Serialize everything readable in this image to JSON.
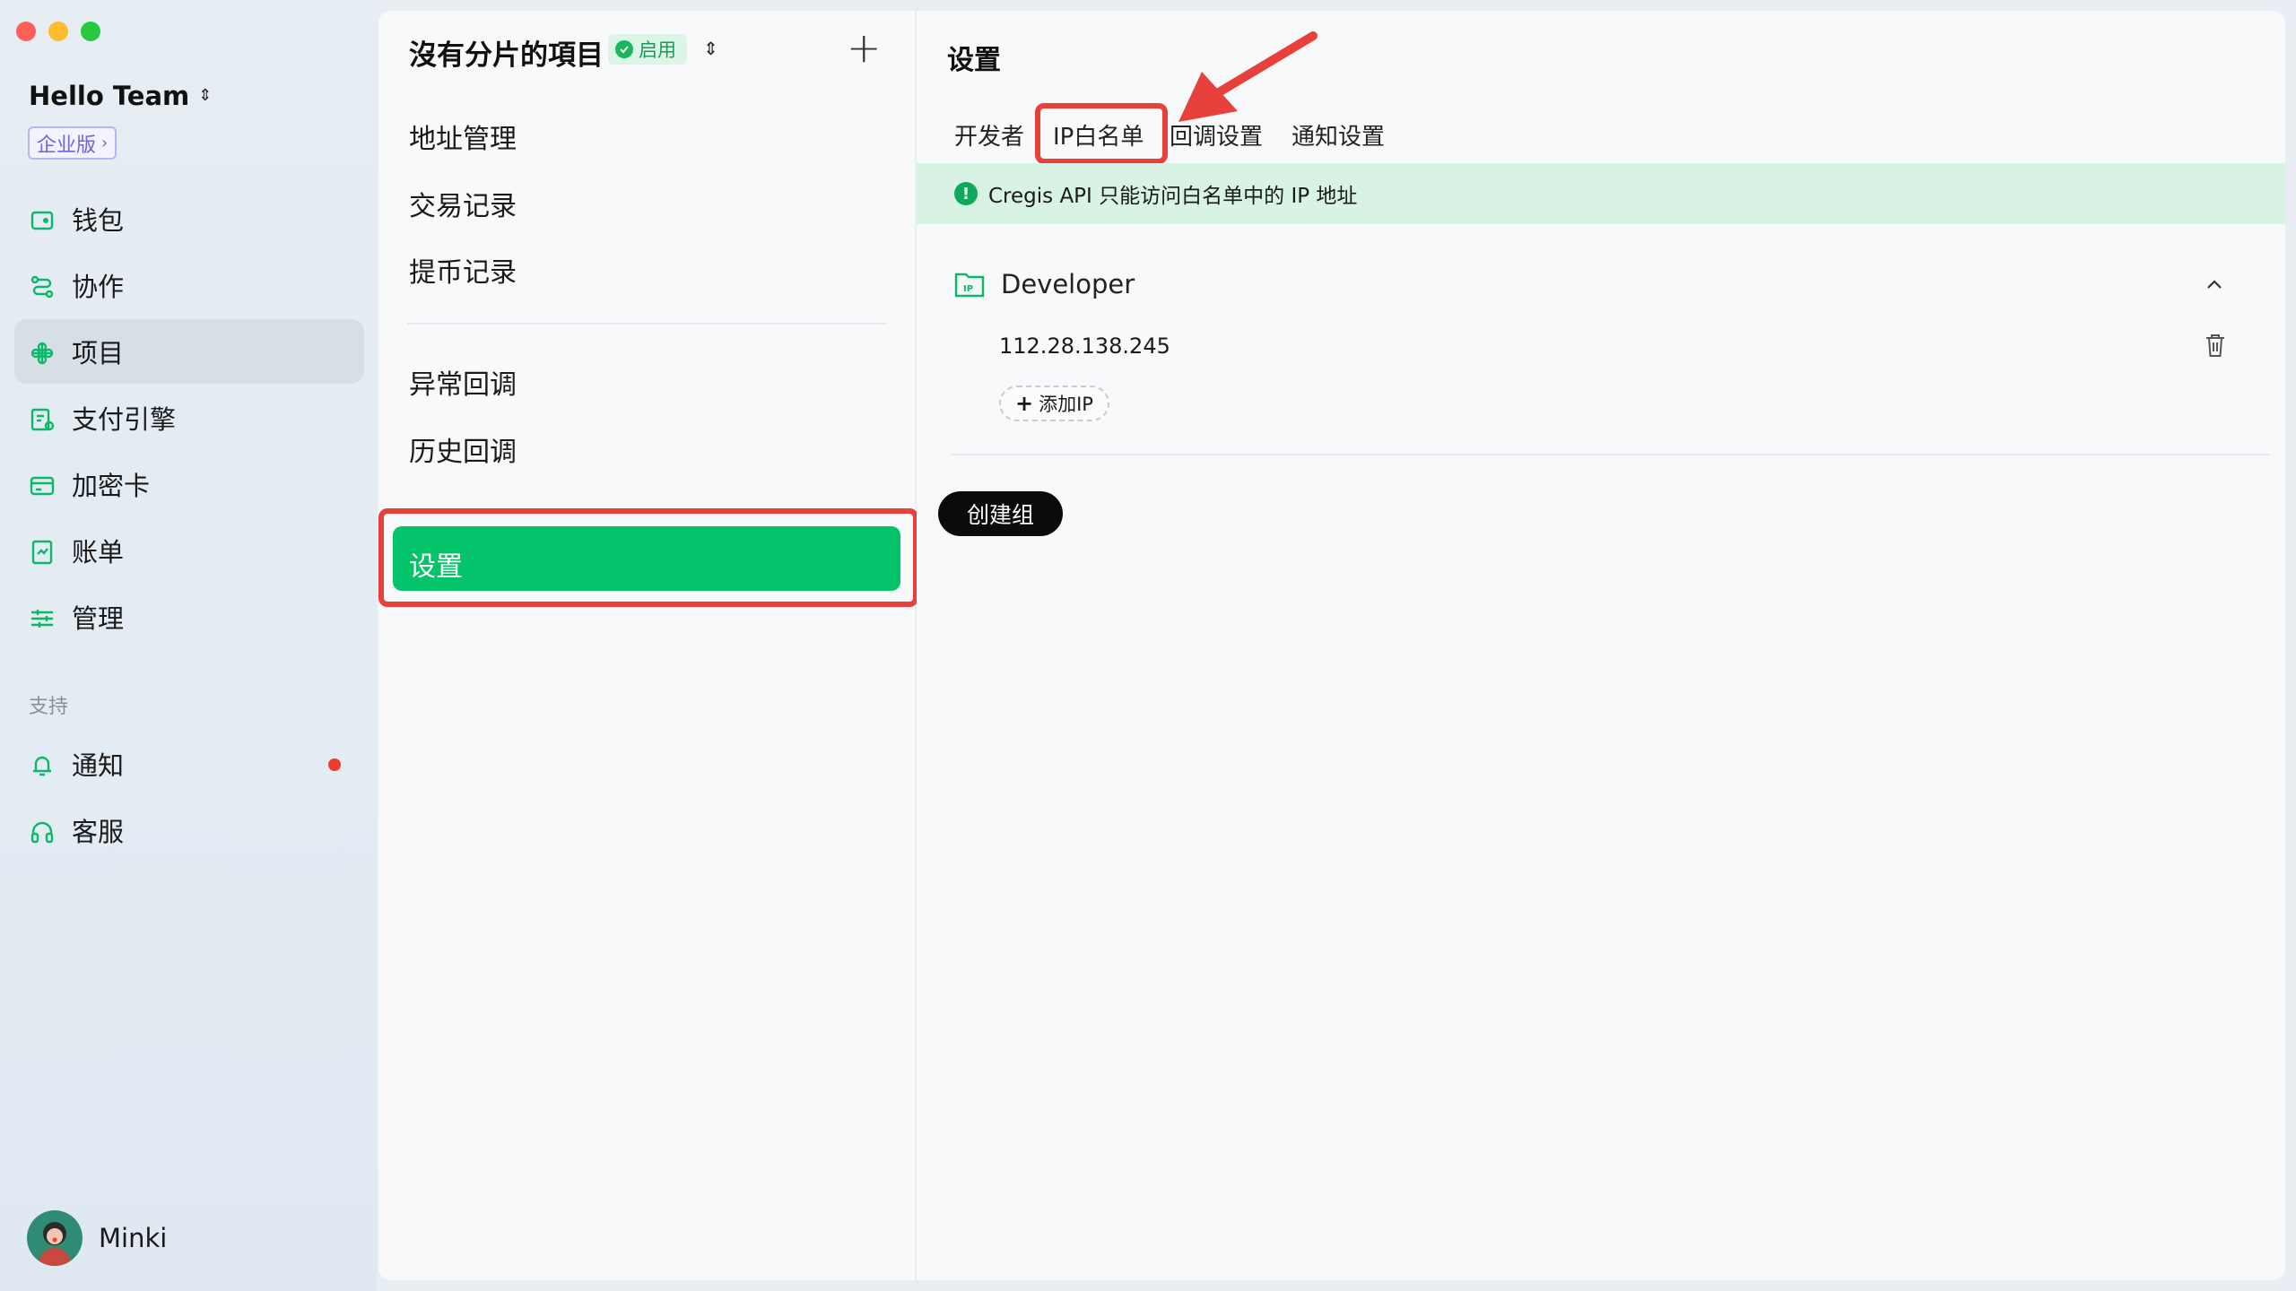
{
  "sidebar": {
    "team_name": "Hello Team",
    "plan_badge": "企业版",
    "nav": [
      {
        "label": "钱包",
        "icon": "wallet-icon"
      },
      {
        "label": "协作",
        "icon": "collaboration-icon"
      },
      {
        "label": "项目",
        "icon": "project-icon",
        "active": true
      },
      {
        "label": "支付引擎",
        "icon": "payment-engine-icon"
      },
      {
        "label": "加密卡",
        "icon": "card-icon"
      },
      {
        "label": "账单",
        "icon": "bill-icon"
      },
      {
        "label": "管理",
        "icon": "settings-sliders-icon"
      }
    ],
    "support_heading": "支持",
    "support": [
      {
        "label": "通知",
        "icon": "bell-icon",
        "unread": true
      },
      {
        "label": "客服",
        "icon": "headset-icon"
      }
    ],
    "user_name": "Minki"
  },
  "project_panel": {
    "title": "沒有分片的項目",
    "status": "启用",
    "menu": [
      "地址管理",
      "交易记录",
      "提币记录"
    ],
    "menu2": [
      "异常回调",
      "历史回调"
    ],
    "active_item": "设置"
  },
  "main": {
    "title": "设置",
    "tabs": [
      "开发者",
      "IP白名单",
      "回调设置",
      "通知设置"
    ],
    "active_tab": "IP白名单",
    "notice": "Cregis API 只能访问白名单中的 IP 地址",
    "group": {
      "name": "Developer",
      "ips": [
        "112.28.138.245"
      ],
      "add_ip_label": "添加IP"
    },
    "create_group_label": "创建组"
  },
  "colors": {
    "accent_green": "#04c36a",
    "highlight_red": "#e8413c",
    "notice_bg": "#d8f2e4"
  }
}
